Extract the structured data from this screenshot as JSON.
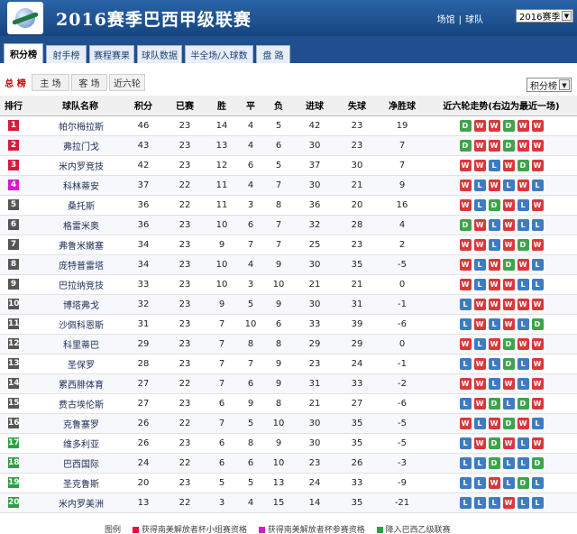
{
  "header": {
    "title": "2016赛季巴西甲级联赛",
    "links": [
      "场馆",
      "球队"
    ],
    "separator": "|",
    "season_select": "2016赛季"
  },
  "tabs": [
    "积分榜",
    "射手榜",
    "赛程赛果",
    "球队数据",
    "半全场/入球数",
    "盘 路"
  ],
  "subtabs": [
    "总 榜",
    "主 场",
    "客 场",
    "近六轮"
  ],
  "table_select": "积分榜",
  "columns": [
    "排行",
    "球队名称",
    "积分",
    "已赛",
    "胜",
    "平",
    "负",
    "进球",
    "失球",
    "净胜球",
    "近六轮走势(右边为最近一场)"
  ],
  "rows": [
    {
      "rank": "1",
      "team": "帕尔梅拉斯",
      "pts": "46",
      "played": "23",
      "w": "14",
      "d": "4",
      "l": "5",
      "gf": "42",
      "ga": "23",
      "gd": "19",
      "form": [
        "D",
        "W",
        "W",
        "D",
        "W",
        "W"
      ],
      "rank_color": "#d61a3c"
    },
    {
      "rank": "2",
      "team": "弗拉门戈",
      "pts": "43",
      "played": "23",
      "w": "13",
      "d": "4",
      "l": "6",
      "gf": "30",
      "ga": "23",
      "gd": "7",
      "form": [
        "D",
        "W",
        "W",
        "D",
        "W",
        "W"
      ],
      "rank_color": "#d61a3c"
    },
    {
      "rank": "3",
      "team": "米内罗竞技",
      "pts": "42",
      "played": "23",
      "w": "12",
      "d": "6",
      "l": "5",
      "gf": "37",
      "ga": "30",
      "gd": "7",
      "form": [
        "W",
        "W",
        "L",
        "W",
        "D",
        "W"
      ],
      "rank_color": "#d61a3c"
    },
    {
      "rank": "4",
      "team": "科林蒂安",
      "pts": "37",
      "played": "22",
      "w": "11",
      "d": "4",
      "l": "7",
      "gf": "30",
      "ga": "21",
      "gd": "9",
      "form": [
        "W",
        "L",
        "W",
        "L",
        "W",
        "L"
      ],
      "rank_color": "#d61ac8"
    },
    {
      "rank": "5",
      "team": "桑托斯",
      "pts": "36",
      "played": "22",
      "w": "11",
      "d": "3",
      "l": "8",
      "gf": "36",
      "ga": "20",
      "gd": "16",
      "form": [
        "W",
        "L",
        "D",
        "W",
        "L",
        "W"
      ],
      "rank_color": "#555555"
    },
    {
      "rank": "6",
      "team": "格雷米奥",
      "pts": "36",
      "played": "23",
      "w": "10",
      "d": "6",
      "l": "7",
      "gf": "32",
      "ga": "28",
      "gd": "4",
      "form": [
        "D",
        "W",
        "L",
        "W",
        "L",
        "L"
      ],
      "rank_color": "#555555"
    },
    {
      "rank": "7",
      "team": "弗鲁米嫩塞",
      "pts": "34",
      "played": "23",
      "w": "9",
      "d": "7",
      "l": "7",
      "gf": "25",
      "ga": "23",
      "gd": "2",
      "form": [
        "W",
        "W",
        "L",
        "W",
        "D",
        "W"
      ],
      "rank_color": "#555555"
    },
    {
      "rank": "8",
      "team": "庞特普雷塔",
      "pts": "34",
      "played": "23",
      "w": "10",
      "d": "4",
      "l": "9",
      "gf": "30",
      "ga": "35",
      "gd": "-5",
      "form": [
        "W",
        "L",
        "W",
        "D",
        "W",
        "L"
      ],
      "rank_color": "#555555"
    },
    {
      "rank": "9",
      "team": "巴拉纳竞技",
      "pts": "33",
      "played": "23",
      "w": "10",
      "d": "3",
      "l": "10",
      "gf": "21",
      "ga": "21",
      "gd": "0",
      "form": [
        "W",
        "L",
        "W",
        "W",
        "L",
        "L"
      ],
      "rank_color": "#555555"
    },
    {
      "rank": "10",
      "team": "博塔弗戈",
      "pts": "32",
      "played": "23",
      "w": "9",
      "d": "5",
      "l": "9",
      "gf": "30",
      "ga": "31",
      "gd": "-1",
      "form": [
        "L",
        "W",
        "W",
        "W",
        "W",
        "W"
      ],
      "rank_color": "#555555"
    },
    {
      "rank": "11",
      "team": "沙佩科恩斯",
      "pts": "31",
      "played": "23",
      "w": "7",
      "d": "10",
      "l": "6",
      "gf": "33",
      "ga": "39",
      "gd": "-6",
      "form": [
        "L",
        "W",
        "L",
        "W",
        "L",
        "D"
      ],
      "rank_color": "#555555"
    },
    {
      "rank": "12",
      "team": "科里蒂巴",
      "pts": "29",
      "played": "23",
      "w": "7",
      "d": "8",
      "l": "8",
      "gf": "29",
      "ga": "29",
      "gd": "0",
      "form": [
        "W",
        "L",
        "W",
        "D",
        "W",
        "W"
      ],
      "rank_color": "#555555"
    },
    {
      "rank": "13",
      "team": "圣保罗",
      "pts": "28",
      "played": "23",
      "w": "7",
      "d": "7",
      "l": "9",
      "gf": "23",
      "ga": "24",
      "gd": "-1",
      "form": [
        "L",
        "W",
        "L",
        "D",
        "L",
        "W"
      ],
      "rank_color": "#555555"
    },
    {
      "rank": "14",
      "team": "累西腓体育",
      "pts": "27",
      "played": "22",
      "w": "7",
      "d": "6",
      "l": "9",
      "gf": "31",
      "ga": "33",
      "gd": "-2",
      "form": [
        "W",
        "W",
        "L",
        "W",
        "L",
        "W"
      ],
      "rank_color": "#555555"
    },
    {
      "rank": "15",
      "team": "费古埃伦斯",
      "pts": "27",
      "played": "23",
      "w": "6",
      "d": "9",
      "l": "8",
      "gf": "21",
      "ga": "27",
      "gd": "-6",
      "form": [
        "L",
        "W",
        "D",
        "L",
        "D",
        "W"
      ],
      "rank_color": "#555555"
    },
    {
      "rank": "16",
      "team": "克鲁塞罗",
      "pts": "26",
      "played": "22",
      "w": "7",
      "d": "5",
      "l": "10",
      "gf": "30",
      "ga": "35",
      "gd": "-5",
      "form": [
        "W",
        "L",
        "W",
        "D",
        "W",
        "L"
      ],
      "rank_color": "#555555"
    },
    {
      "rank": "17",
      "team": "维多利亚",
      "pts": "26",
      "played": "23",
      "w": "6",
      "d": "8",
      "l": "9",
      "gf": "30",
      "ga": "35",
      "gd": "-5",
      "form": [
        "L",
        "W",
        "D",
        "W",
        "L",
        "W"
      ],
      "rank_color": "#2ea043"
    },
    {
      "rank": "18",
      "team": "巴西国际",
      "pts": "24",
      "played": "22",
      "w": "6",
      "d": "6",
      "l": "10",
      "gf": "23",
      "ga": "26",
      "gd": "-3",
      "form": [
        "L",
        "L",
        "D",
        "L",
        "L",
        "D"
      ],
      "rank_color": "#2ea043"
    },
    {
      "rank": "19",
      "team": "圣克鲁斯",
      "pts": "20",
      "played": "23",
      "w": "5",
      "d": "5",
      "l": "13",
      "gf": "24",
      "ga": "33",
      "gd": "-9",
      "form": [
        "L",
        "L",
        "W",
        "L",
        "D",
        "L"
      ],
      "rank_color": "#2ea043"
    },
    {
      "rank": "20",
      "team": "米内罗美洲",
      "pts": "13",
      "played": "22",
      "w": "3",
      "d": "4",
      "l": "15",
      "gf": "14",
      "ga": "35",
      "gd": "-21",
      "form": [
        "L",
        "L",
        "L",
        "W",
        "L",
        "L"
      ],
      "rank_color": "#2ea043"
    }
  ],
  "footer": {
    "label": "图例",
    "items": [
      {
        "text": "获得南美解放者杯小组赛资格",
        "color": "#d61a3c"
      },
      {
        "text": "获得南美解放者杯参赛资格",
        "color": "#d61ac8"
      },
      {
        "text": "降入巴西乙级联赛",
        "color": "#2ea043"
      }
    ]
  }
}
